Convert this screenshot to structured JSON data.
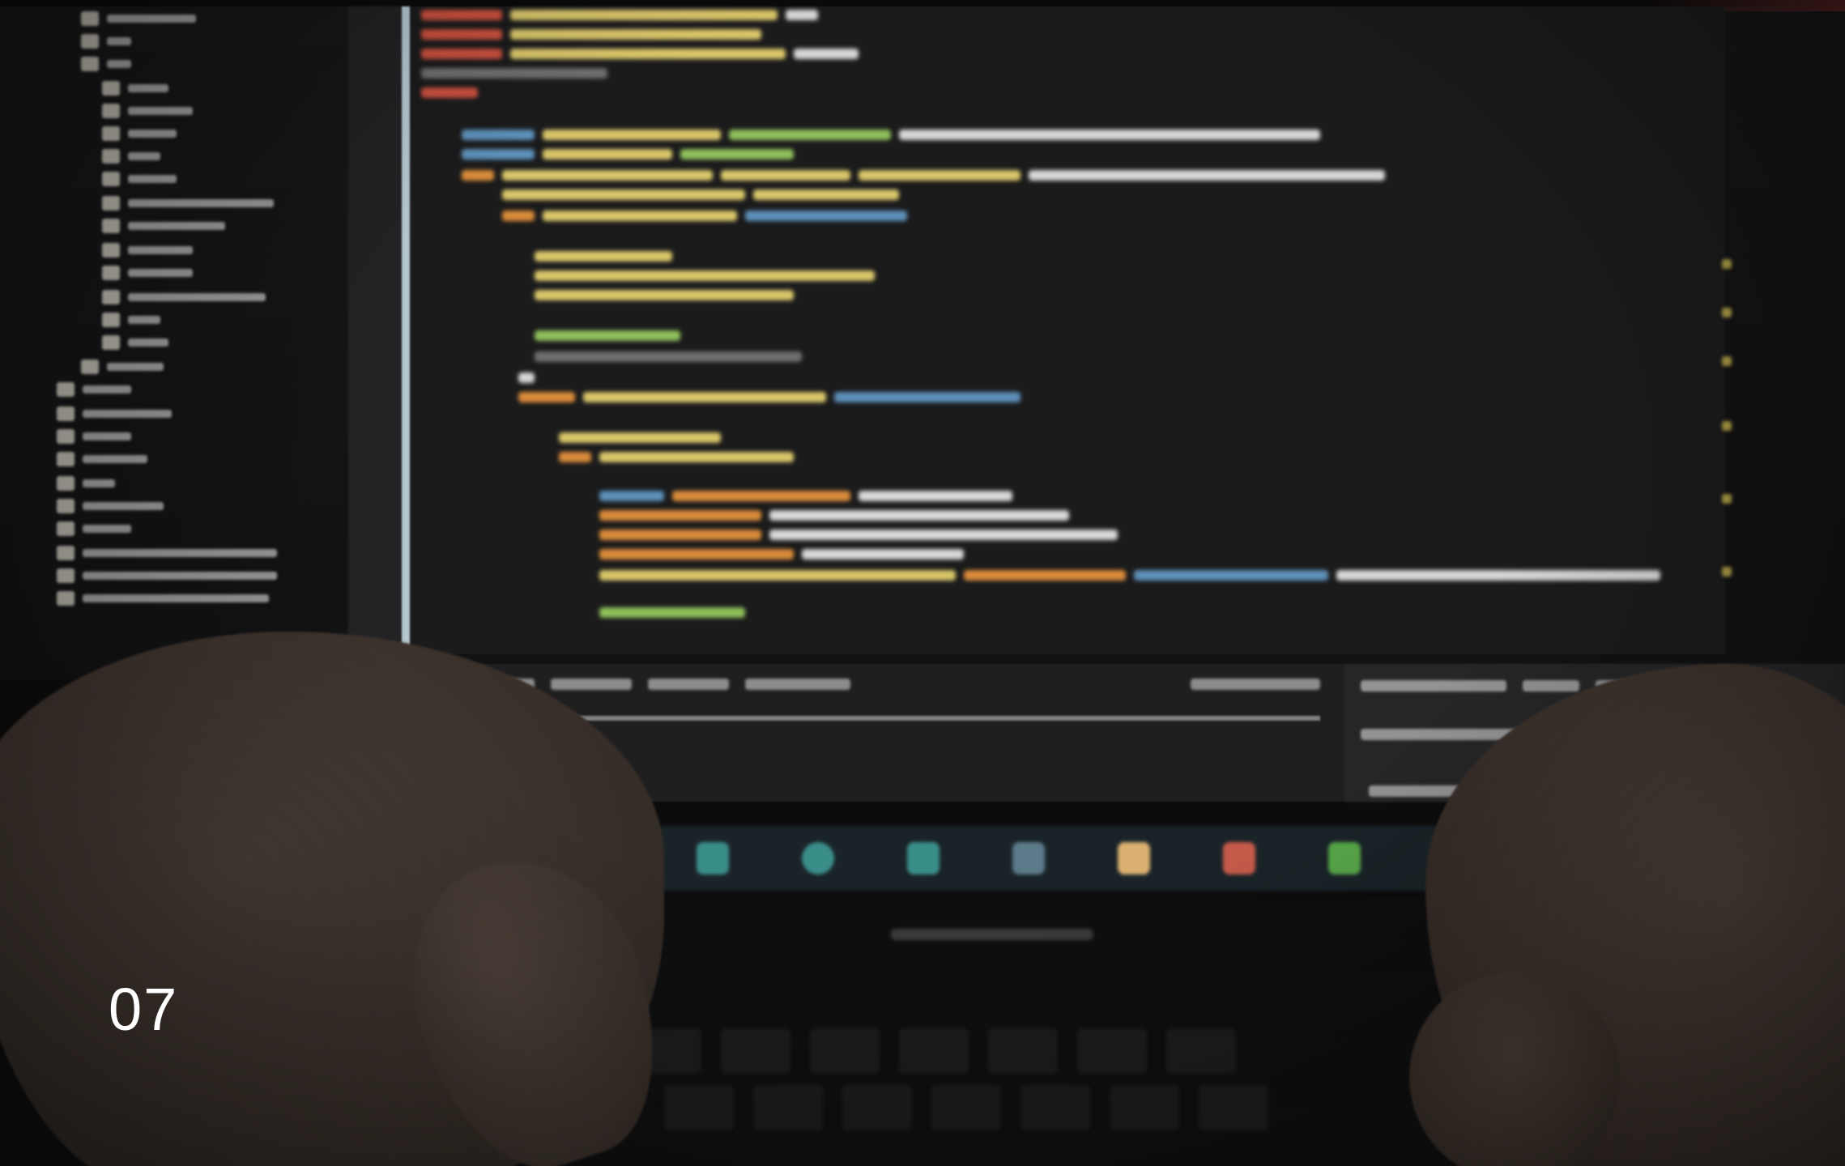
{
  "overlay": {
    "slide_number": "07"
  },
  "colors": {
    "code_yellow": "#d9c66a",
    "code_orange": "#d98b3a",
    "code_blue": "#5d8fb8",
    "code_green": "#8fbf5a",
    "editor_background": "#1b1b1c",
    "overlay_text": "#ffffff"
  },
  "icons": [
    "folder-icon",
    "taskbar-app-icon"
  ]
}
